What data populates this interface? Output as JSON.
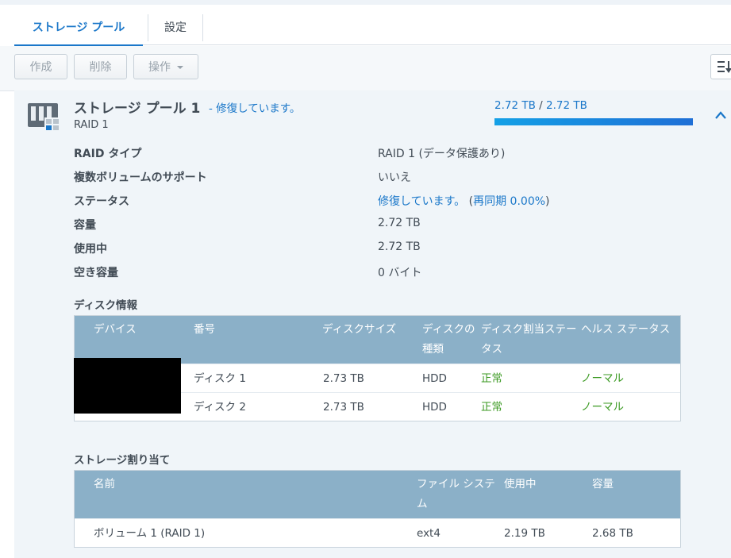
{
  "tabs": [
    {
      "label": "ストレージ プール"
    },
    {
      "label": "設定"
    }
  ],
  "toolbar": {
    "create_label": "作成",
    "delete_label": "削除",
    "action_label": "操作"
  },
  "pool": {
    "title": "ストレージ プール 1",
    "status": "- 修復しています。",
    "raid": "RAID 1",
    "usage_used": "2.72 TB",
    "usage_sep": " / ",
    "usage_total": "2.72 TB",
    "usage_fraction": 1.0
  },
  "details": [
    {
      "label": "RAID タイプ",
      "value": "RAID 1 (データ保護あり)"
    },
    {
      "label": "複数ボリュームのサポート",
      "value": "いいえ"
    },
    {
      "label": "ステータス",
      "value": "修復しています。",
      "value_extra_prefix": " (",
      "value_extra": "再同期 0.00%",
      "value_extra_suffix": ")"
    },
    {
      "label": "容量",
      "value": "2.72 TB"
    },
    {
      "label": "使用中",
      "value": "2.72 TB"
    },
    {
      "label": "空き容量",
      "value": "0 バイト"
    }
  ],
  "disk_section": {
    "title": "ディスク情報",
    "headers": [
      "デバイス",
      "番号",
      "ディスクサイズ",
      "ディスクの",
      "種類",
      "ディスク割当ステー",
      "タス",
      "ヘルス ステータス"
    ],
    "rows": [
      {
        "number": "ディスク 1",
        "size": "2.73 TB",
        "type": "HDD",
        "alloc": "正常",
        "health": "ノーマル"
      },
      {
        "number": "ディスク 2",
        "size": "2.73 TB",
        "type": "HDD",
        "alloc": "正常",
        "health": "ノーマル"
      }
    ]
  },
  "storage_section": {
    "title": "ストレージ割り当て",
    "headers": [
      "名前",
      "ファイル システ",
      "ム",
      "使用中",
      "容量"
    ],
    "rows": [
      {
        "name": "ボリューム 1 (RAID 1)",
        "fs": "ext4",
        "used": "2.19 TB",
        "capacity": "2.68 TB"
      }
    ]
  },
  "colors": {
    "accent": "#1a77c9",
    "header_bg": "#8bb0c8",
    "panel_bg": "#f0f5f9",
    "ok_green": "#3b9a22"
  },
  "icons": [
    "storage-pool-icon",
    "chevron-up-icon",
    "sort-icon",
    "caret-down-icon"
  ]
}
